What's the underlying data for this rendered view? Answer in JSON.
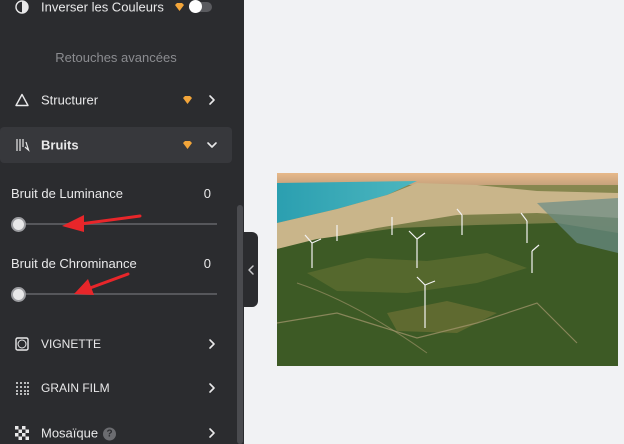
{
  "sidebar": {
    "invert": {
      "label": "Inverser les Couleurs",
      "enabled": false
    },
    "section_title": "Retouches avancées",
    "structurer": {
      "label": "Structurer"
    },
    "bruits": {
      "label": "Bruits",
      "luminance": {
        "label": "Bruit de Luminance",
        "value": "0",
        "level": 0
      },
      "chrominance": {
        "label": "Bruit de Chrominance",
        "value": "0",
        "level": 0
      }
    },
    "vignette": {
      "label": "VIGNETTE"
    },
    "grain": {
      "label": "GRAIN FILM"
    },
    "mosaique": {
      "label": "Mosaïque",
      "help": "?"
    }
  },
  "colors": {
    "sidebar_bg": "#2b2c2f",
    "premium_diamond": "#f2a53a",
    "annotation_arrow": "#e8262a",
    "canvas_bg": "#f1f2f4"
  },
  "icons": {
    "invert": "half-circle-icon",
    "structurer": "triangle-icon",
    "bruits": "noise-lines-icon",
    "vignette": "vignette-square-icon",
    "grain": "grain-dots-icon",
    "mosaique": "checkerboard-icon"
  }
}
